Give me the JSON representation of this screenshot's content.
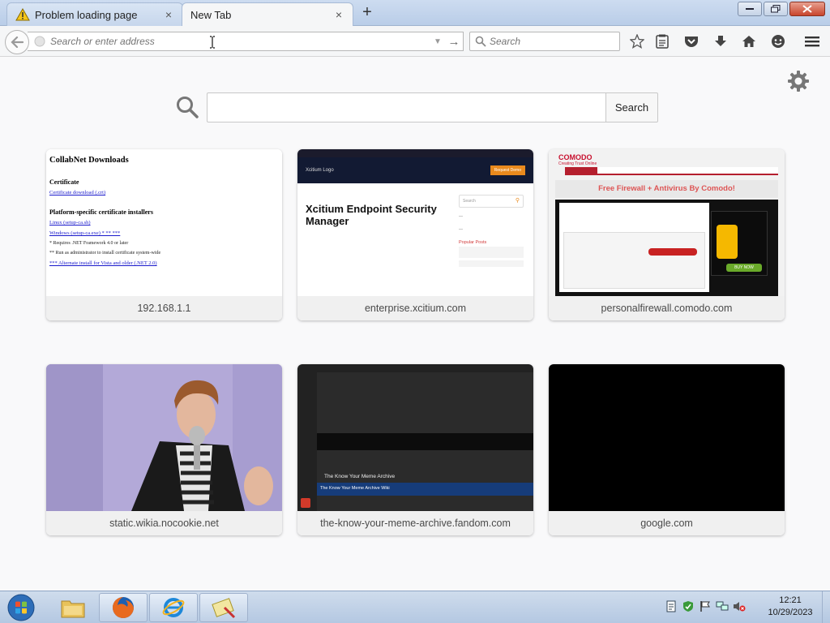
{
  "tabs": [
    {
      "title": "Problem loading page",
      "active": false
    },
    {
      "title": "New Tab",
      "active": true
    }
  ],
  "address_bar": {
    "placeholder": "Search or enter address",
    "value": ""
  },
  "search_bar": {
    "placeholder": "Search"
  },
  "content": {
    "search_button": "Search",
    "tiles": [
      {
        "label": "192.168.1.1"
      },
      {
        "label": "enterprise.xcitium.com"
      },
      {
        "label": "personalfirewall.comodo.com"
      },
      {
        "label": "static.wikia.nocookie.net"
      },
      {
        "label": "the-know-your-meme-archive.fandom.com"
      },
      {
        "label": "google.com"
      }
    ]
  },
  "thumb_collabnet": {
    "heading": "CollabNet Downloads",
    "certificate_heading": "Certificate",
    "certificate_link": "Certificate download (.crt)",
    "installers_heading": "Platform-specific certificate installers",
    "link_linux": "Linux (setup-ca.sh)",
    "link_windows": "Windows (setup-ca.exe) * ** ***",
    "note1": "* Requires .NET Framework 4.0 or later",
    "note2": "** Run as administrator to install certificate system-wide",
    "note3": "*** Alternate install for Vista and older (.NET 2.0)"
  },
  "thumb_xcitium": {
    "brand": "Xcitium Logo",
    "hero": "Xcitium Endpoint Security Manager",
    "button": "Request Demo",
    "search": "Search",
    "popular_posts": "Popular Posts"
  },
  "thumb_comodo": {
    "logo": "COMODO",
    "tagline": "Creating Trust Online",
    "banner": "Free Firewall + Antivirus By Comodo!",
    "buy": "BUY NOW"
  },
  "thumb_kym": {
    "title": "The Know Your Meme Archive",
    "bar": "The Know Your Meme Archive Wiki"
  },
  "taskbar": {
    "time": "12:21",
    "date": "10/29/2023"
  },
  "colors": {
    "accent": "#0a84ff",
    "tab_strip": "#c6d6ec",
    "comodo_red": "#c8102e",
    "xcitium_orange": "#e98a1d"
  }
}
